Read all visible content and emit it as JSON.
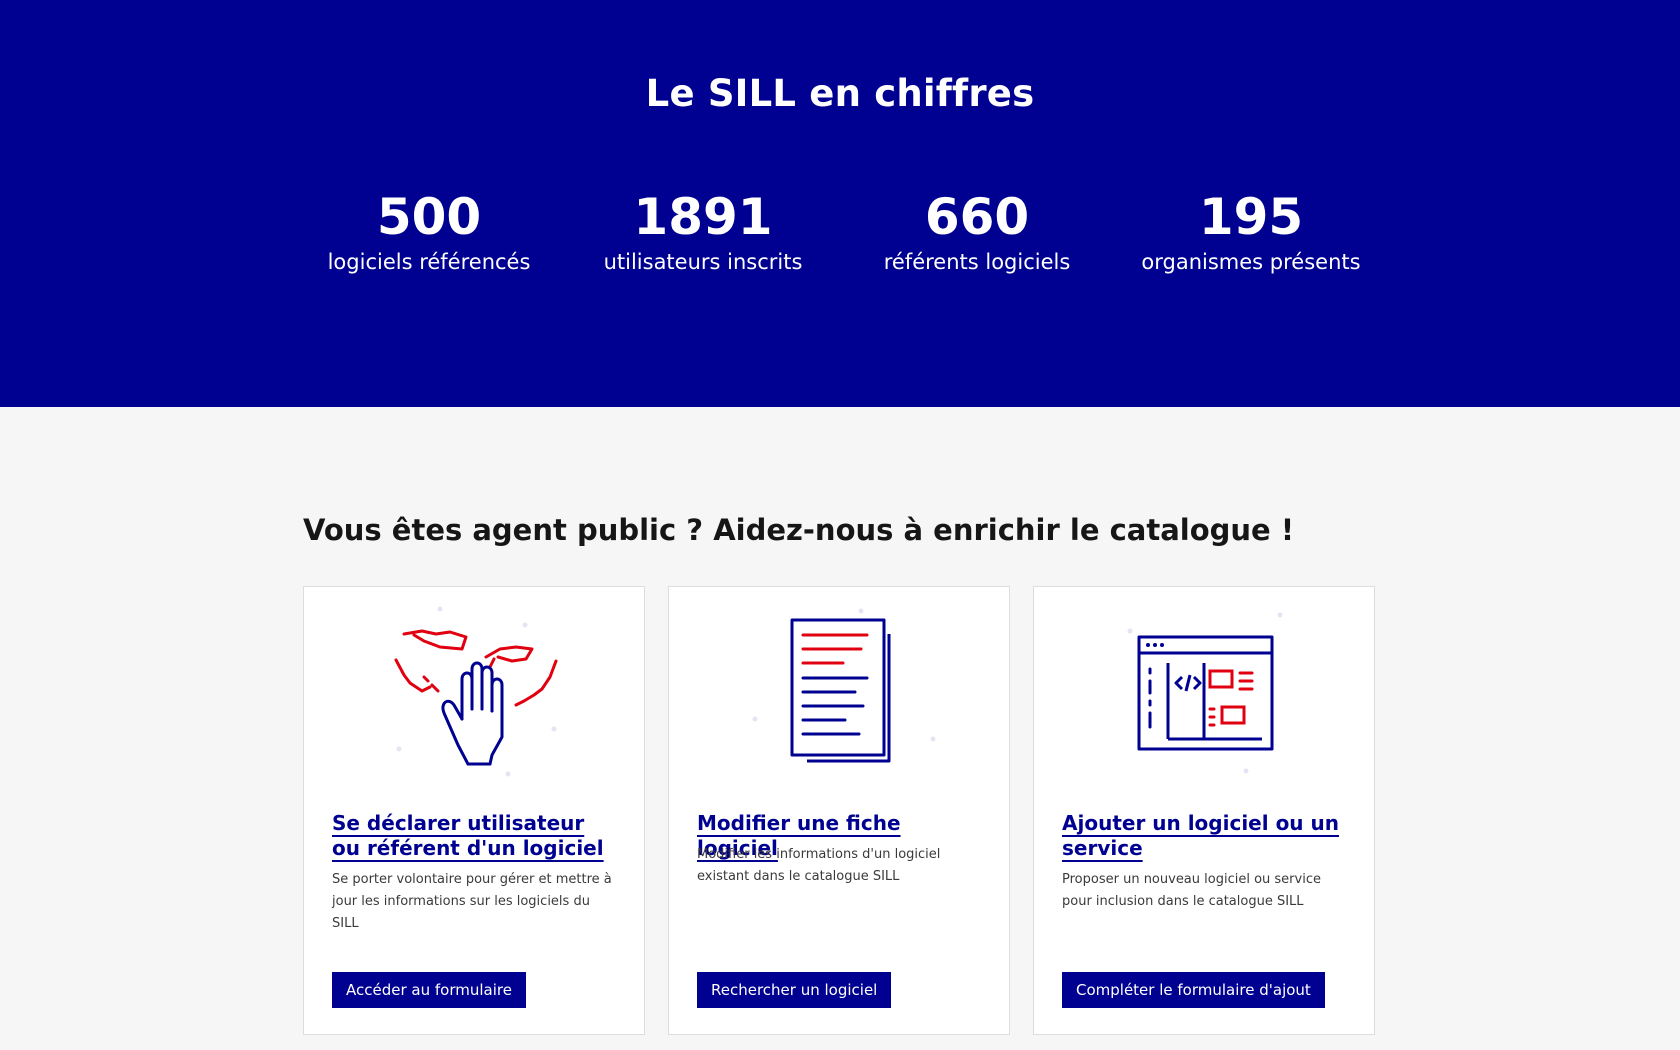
{
  "stats": {
    "title": "Le SILL en chiffres",
    "items": [
      {
        "value": "500",
        "label": "logiciels référencés"
      },
      {
        "value": "1891",
        "label": "utilisateurs inscrits"
      },
      {
        "value": "660",
        "label": "référents logiciels"
      },
      {
        "value": "195",
        "label": "organismes présents"
      }
    ]
  },
  "contribute": {
    "heading": "Vous êtes agent public ? Aidez-nous à enrichir le catalogue !",
    "cards": [
      {
        "icon": "raised-hands-icon",
        "title": "Se déclarer utilisateur ou référent d'un logiciel",
        "description": "Se porter volontaire pour gérer et mettre à jour les informations sur les logiciels du SILL",
        "button": "Accéder au formulaire"
      },
      {
        "icon": "document-icon",
        "title": "Modifier une fiche logiciel",
        "description": "Modifier les informations d'un logiciel existant dans le catalogue SILL",
        "button": "Rechercher un logiciel"
      },
      {
        "icon": "code-window-icon",
        "title": "Ajouter un logiciel ou un service",
        "description": "Proposer un nouveau logiciel ou service pour inclusion dans le catalogue SILL",
        "button": "Compléter le formulaire d'ajout"
      }
    ]
  },
  "colors": {
    "primary": "#000091",
    "accent": "#e1000f",
    "background": "#f6f6f6"
  }
}
